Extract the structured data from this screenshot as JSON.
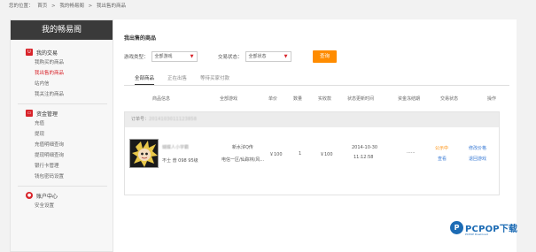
{
  "breadcrumb": {
    "prefix": "您的位置：",
    "items": [
      "首页",
      "我的畅易阁",
      "我出售的商品"
    ],
    "sep": ">"
  },
  "sidebar": {
    "title": "我的畅易阁",
    "sections": [
      {
        "title": "我的交易",
        "icon": "shopping-icon",
        "items": [
          {
            "label": "我购买的商品",
            "active": false
          },
          {
            "label": "我出售的商品",
            "active": true
          },
          {
            "label": "站内信",
            "active": false
          },
          {
            "label": "我关注的商品",
            "active": false
          }
        ]
      },
      {
        "title": "资金管理",
        "icon": "wallet-icon",
        "items": [
          {
            "label": "充值",
            "active": false
          },
          {
            "label": "提现",
            "active": false
          },
          {
            "label": "充值明细查询",
            "active": false
          },
          {
            "label": "提现明细查询",
            "active": false
          },
          {
            "label": "银行卡管理",
            "active": false
          },
          {
            "label": "钱包密码设置",
            "active": false
          }
        ]
      },
      {
        "title": "账户中心",
        "icon": "user-icon",
        "items": [
          {
            "label": "安全设置",
            "active": false
          }
        ]
      }
    ]
  },
  "main": {
    "title": "我出售的商品",
    "filters": {
      "game_label": "游戏类型：",
      "game_value": "全部游戏",
      "status_label": "交易状态：",
      "status_value": "全部状态",
      "search_label": "查询"
    },
    "tabs": [
      {
        "label": "全部商品",
        "active": true
      },
      {
        "label": "正在出售",
        "active": false
      },
      {
        "label": "等待买家付款",
        "active": false
      }
    ],
    "columns": [
      "商品信息",
      "全部游戏",
      "单价",
      "数量",
      "实收款",
      "状态更新时间",
      "资金冻结期",
      "交易状态",
      "操作"
    ],
    "orders": [
      {
        "order_no_label": "订单号：",
        "order_no": "2014103011123858",
        "item_name": "蝴蝶人小学霸",
        "item_sub": "不士 普 098 95级",
        "game": "新水浒Q传",
        "server": "电信一区/仙踪林/风...",
        "price": "￥100",
        "qty": "1",
        "received": "￥100",
        "update_date": "2014-10-30",
        "update_time": "11:12:58",
        "freeze": "......",
        "status": "公示中",
        "view_label": "查看",
        "action1": "修改价格",
        "action2": "退回游戏"
      }
    ]
  },
  "watermark": {
    "text": "PCPOP下载",
    "sub": "PCPOP Download"
  }
}
